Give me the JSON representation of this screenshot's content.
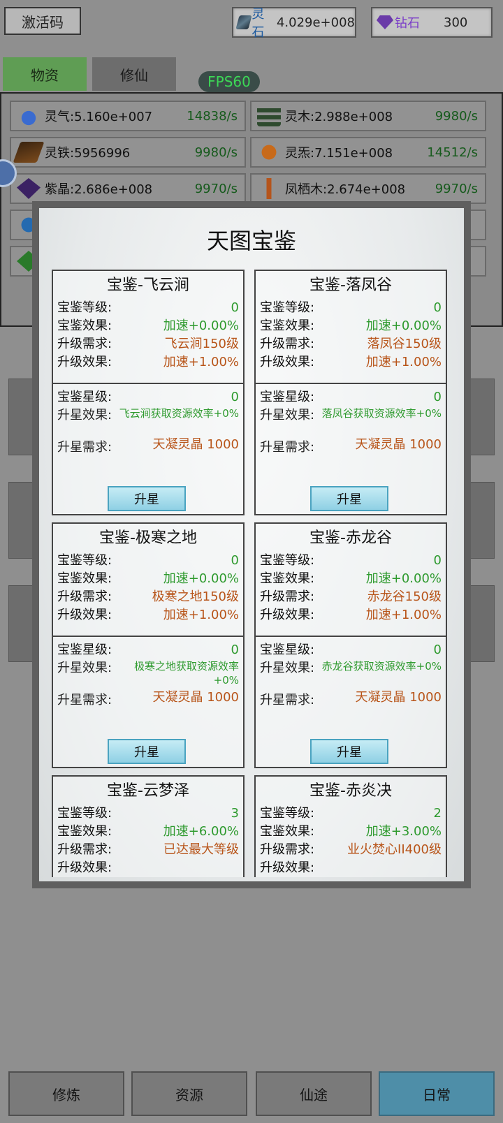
{
  "top": {
    "code_label": "激活码",
    "stone_name": "灵石",
    "stone_value": "4.029e+008",
    "gem_name": "钻石",
    "gem_value": "300",
    "fps": "FPS60"
  },
  "tabs": [
    "物资",
    "修仙"
  ],
  "resources": [
    {
      "name": "灵气:5.160e+007",
      "rate": "14838/s",
      "icon": "qi-icon"
    },
    {
      "name": "灵木:2.988e+008",
      "rate": "9980/s",
      "icon": "wood-icon"
    },
    {
      "name": "灵铁:5956996",
      "rate": "9980/s",
      "icon": "iron-icon"
    },
    {
      "name": "灵炁:7.151e+008",
      "rate": "14512/s",
      "icon": "luan-icon"
    },
    {
      "name": "紫晶:2.686e+008",
      "rate": "9970/s",
      "icon": "crystal-icon"
    },
    {
      "name": "凤栖木:2.674e+008",
      "rate": "9970/s",
      "icon": "phoenix-wood-icon"
    }
  ],
  "modal": {
    "title": "天图宝鉴",
    "labels": {
      "level": "宝鉴等级:",
      "effect": "宝鉴效果:",
      "req": "升级需求:",
      "upeff": "升级效果:",
      "star": "宝鉴星级:",
      "star_eff": "升星效果:",
      "star_req": "升星需求:"
    },
    "upgrade_label": "升星",
    "cards": [
      {
        "title": "宝鉴-飞云涧",
        "level": "0",
        "effect": "加速+0.00%",
        "req": "飞云涧150级",
        "upeff": "加速+1.00%",
        "star": "0",
        "star_eff": "飞云涧获取资源效率+0%",
        "star_req": "天凝灵晶 1000"
      },
      {
        "title": "宝鉴-落凤谷",
        "level": "0",
        "effect": "加速+0.00%",
        "req": "落凤谷150级",
        "upeff": "加速+1.00%",
        "star": "0",
        "star_eff": "落凤谷获取资源效率+0%",
        "star_req": "天凝灵晶 1000"
      },
      {
        "title": "宝鉴-极寒之地",
        "level": "0",
        "effect": "加速+0.00%",
        "req": "极寒之地150级",
        "upeff": "加速+1.00%",
        "star": "0",
        "star_eff": "极寒之地获取资源效率+0%",
        "star_req": "天凝灵晶 1000"
      },
      {
        "title": "宝鉴-赤龙谷",
        "level": "0",
        "effect": "加速+0.00%",
        "req": "赤龙谷150级",
        "upeff": "加速+1.00%",
        "star": "0",
        "star_eff": "赤龙谷获取资源效率+0%",
        "star_req": "天凝灵晶 1000"
      },
      {
        "title": "宝鉴-云梦泽",
        "level": "3",
        "effect": "加速+6.00%",
        "req": "已达最大等级",
        "upeff": "",
        "star": "",
        "star_eff": "",
        "star_req": ""
      },
      {
        "title": "宝鉴-赤炎决",
        "level": "2",
        "effect": "加速+3.00%",
        "req": "业火焚心II400级",
        "upeff": "",
        "star": "",
        "star_eff": "",
        "star_req": ""
      }
    ]
  },
  "nav": [
    "修炼",
    "资源",
    "仙途",
    "日常"
  ],
  "colors": {
    "green": "#2e9a2e",
    "orange": "#b8551a",
    "fps": "#3cd856",
    "active_tab": "#5f9d54",
    "active_nav": "#4e8ea8"
  }
}
